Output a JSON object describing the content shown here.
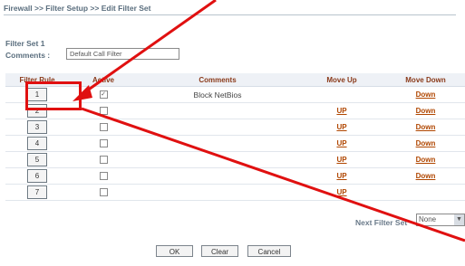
{
  "breadcrumb": "Firewall >> Filter Setup >> Edit Filter Set",
  "filter_set_title": "Filter Set 1",
  "comments_label": "Comments :",
  "comments_value": "Default Call Filter",
  "table": {
    "headers": [
      "Filter Rule",
      "Active",
      "Comments",
      "Move Up",
      "Move Down"
    ],
    "rows": [
      {
        "rule": "1",
        "active": true,
        "comment": "Block NetBios",
        "up": "",
        "down": "Down"
      },
      {
        "rule": "2",
        "active": false,
        "comment": "",
        "up": "UP",
        "down": "Down"
      },
      {
        "rule": "3",
        "active": false,
        "comment": "",
        "up": "UP",
        "down": "Down"
      },
      {
        "rule": "4",
        "active": false,
        "comment": "",
        "up": "UP",
        "down": "Down"
      },
      {
        "rule": "5",
        "active": false,
        "comment": "",
        "up": "UP",
        "down": "Down"
      },
      {
        "rule": "6",
        "active": false,
        "comment": "",
        "up": "UP",
        "down": "Down"
      },
      {
        "rule": "7",
        "active": false,
        "comment": "",
        "up": "UP",
        "down": ""
      }
    ]
  },
  "next_filter_set_label": "Next Filter Set",
  "next_filter_set_value": "None",
  "buttons": {
    "ok": "OK",
    "clear": "Clear",
    "cancel": "Cancel"
  },
  "colors": {
    "annotation_red": "#e01010",
    "header_text": "#8a3a1a",
    "link": "#b04600"
  }
}
